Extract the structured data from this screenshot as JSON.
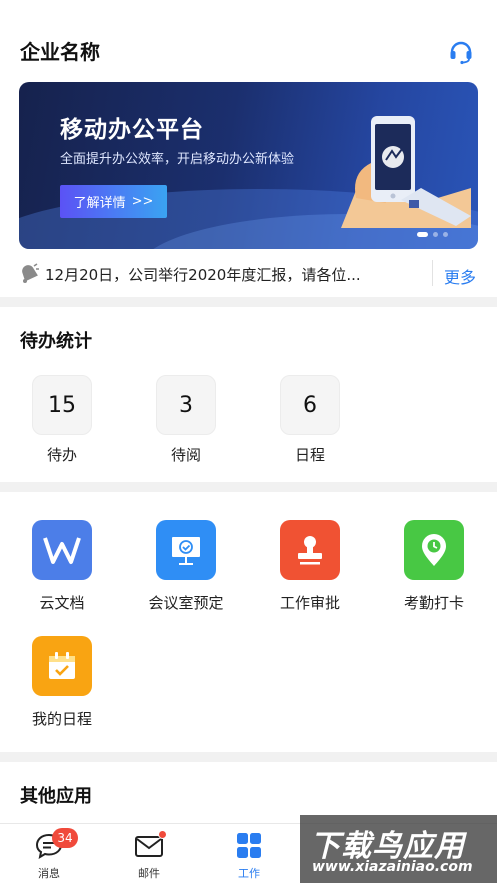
{
  "header": {
    "title": "企业名称",
    "support_icon": "headset-icon"
  },
  "banner": {
    "title": "移动办公平台",
    "subtitle": "全面提升办公效率，开启移动办公新体验",
    "button_label": "了解详情",
    "button_arrow": ">>",
    "active_slide": 1,
    "slide_count": 3
  },
  "notice": {
    "icon": "bell-icon",
    "text": "12月20日，公司举行2020年度汇报，请各位...",
    "more_label": "更多"
  },
  "todo": {
    "title": "待办统计",
    "items": [
      {
        "count": "15",
        "label": "待办"
      },
      {
        "count": "3",
        "label": "待阅"
      },
      {
        "count": "6",
        "label": "日程"
      }
    ]
  },
  "apps": [
    {
      "label": "云文档",
      "icon": "document-w-icon",
      "color": "#4c7ee8"
    },
    {
      "label": "会议室预定",
      "icon": "meeting-board-icon",
      "color": "#2f8ef5"
    },
    {
      "label": "工作审批",
      "icon": "stamp-icon",
      "color": "#f05233"
    },
    {
      "label": "考勤打卡",
      "icon": "location-clock-icon",
      "color": "#48c844"
    },
    {
      "label": "我的日程",
      "icon": "calendar-check-icon",
      "color": "#f9a412"
    }
  ],
  "other_apps": {
    "title": "其他应用"
  },
  "tabbar": {
    "active_color": "#2a7df0",
    "items": [
      {
        "label": "消息",
        "icon": "chat-bubble-icon",
        "badge": "34"
      },
      {
        "label": "邮件",
        "icon": "mail-icon"
      },
      {
        "label": "工作",
        "icon": "grid-apps-icon"
      }
    ]
  },
  "watermark": {
    "line1": "下载鸟应用",
    "line2": "www.xiazainiao.com"
  }
}
